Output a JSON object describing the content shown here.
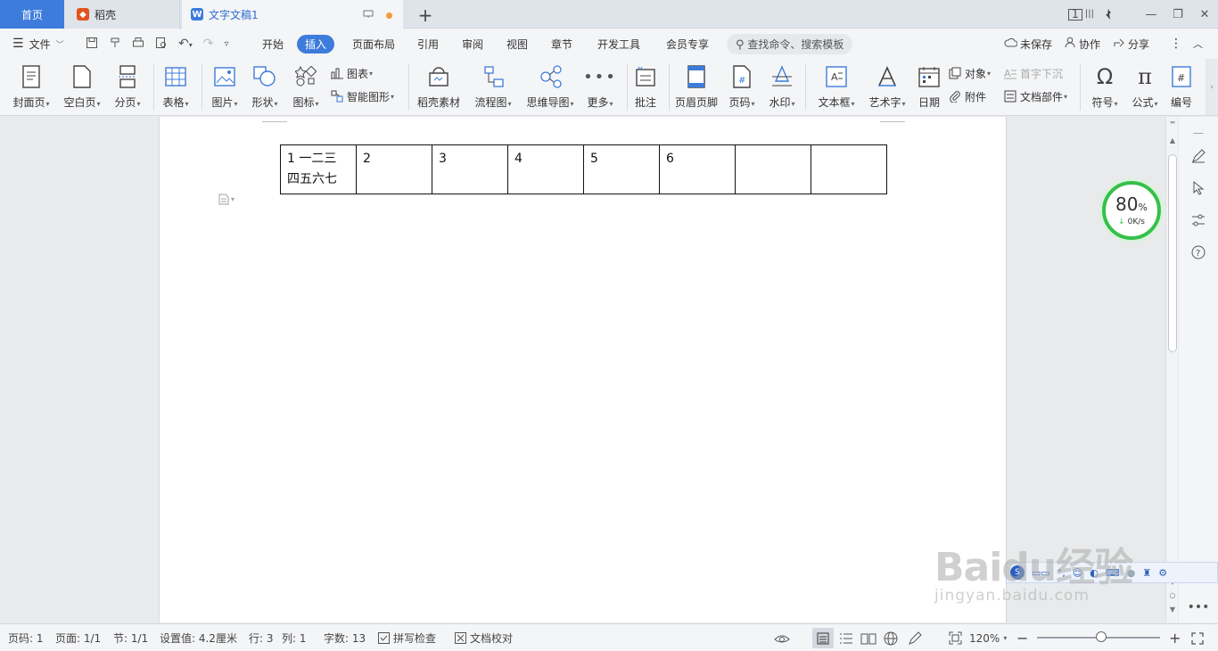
{
  "tabs": {
    "home": "首页",
    "docer": "稻壳",
    "document": "文字文稿1",
    "new_tab_symbol": "+",
    "window_badge": "1"
  },
  "menu": {
    "file": "文件",
    "tabs": [
      "开始",
      "插入",
      "页面布局",
      "引用",
      "审阅",
      "视图",
      "章节",
      "开发工具",
      "会员专享"
    ],
    "active_tab": "插入",
    "search_placeholder": "查找命令、搜索模板",
    "unsaved": "未保存",
    "collaborate": "协作",
    "share": "分享"
  },
  "ribbon": {
    "cover_page": "封面页",
    "blank_page": "空白页",
    "page_break": "分页",
    "table": "表格",
    "picture": "图片",
    "shape": "形状",
    "icon": "图标",
    "chart": "图表",
    "smart_art": "智能图形",
    "docer_assets": "稻壳素材",
    "flowchart": "流程图",
    "mind_map": "思维导图",
    "more": "更多",
    "comment": "批注",
    "header_footer": "页眉页脚",
    "page_number": "页码",
    "watermark": "水印",
    "text_box": "文本框",
    "word_art": "艺术字",
    "date": "日期",
    "object": "对象",
    "attachment": "附件",
    "drop_cap": "首字下沉",
    "doc_parts": "文档部件",
    "symbol": "符号",
    "formula": "公式",
    "numbering": "编号"
  },
  "document": {
    "table": [
      [
        "1 一二三\n四五六七",
        "2",
        "3",
        "4",
        "5",
        "6",
        "",
        ""
      ]
    ]
  },
  "speed_widget": {
    "percent": "80",
    "percent_sign": "%",
    "rate": "0K/s"
  },
  "status": {
    "page_num": "页码: 1",
    "pages": "页面: 1/1",
    "section": "节: 1/1",
    "position": "设置值: 4.2厘米",
    "row": "行: 3",
    "col": "列: 1",
    "word_count": "字数: 13",
    "spell_check": "拼写检查",
    "proofread": "文档校对",
    "zoom": "120%"
  },
  "watermark": {
    "brand": "Baidu经验",
    "url": "jingyan.baidu.com"
  },
  "colors": {
    "accent": "#3d7cdb",
    "speed_ring": "#35c04a",
    "unsaved_dot": "#f29b3a"
  }
}
